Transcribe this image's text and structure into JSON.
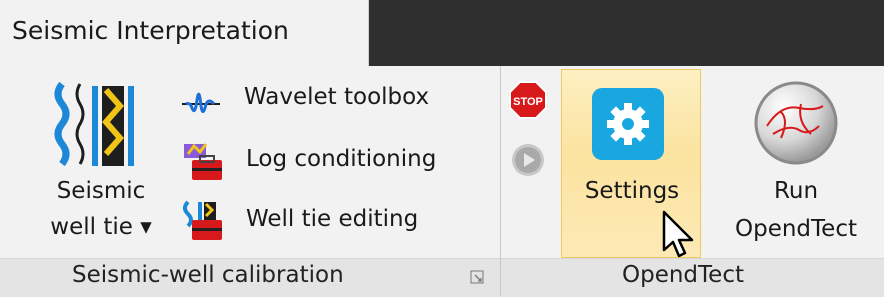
{
  "tab": {
    "label": "Seismic Interpretation"
  },
  "groups": {
    "calibration": {
      "label": "Seismic-well calibration",
      "seismic_well_tie": {
        "line1": "Seismic",
        "line2": "well tie ▾"
      },
      "wavelet_toolbox": "Wavelet toolbox",
      "log_conditioning": "Log conditioning",
      "well_tie_editing": "Well tie editing"
    },
    "opendtect": {
      "label": "OpendTect",
      "settings": "Settings",
      "run": {
        "line1": "Run",
        "line2": "OpendTect"
      }
    }
  },
  "icons": {
    "stop": "stop-sign-icon",
    "play": "play-icon",
    "gear": "gear-icon",
    "run": "opendtect-logo-icon"
  },
  "colors": {
    "settings_accent": "#1aa6df",
    "hover_fill": "#fbe3a0",
    "stop_red": "#d7191c"
  }
}
